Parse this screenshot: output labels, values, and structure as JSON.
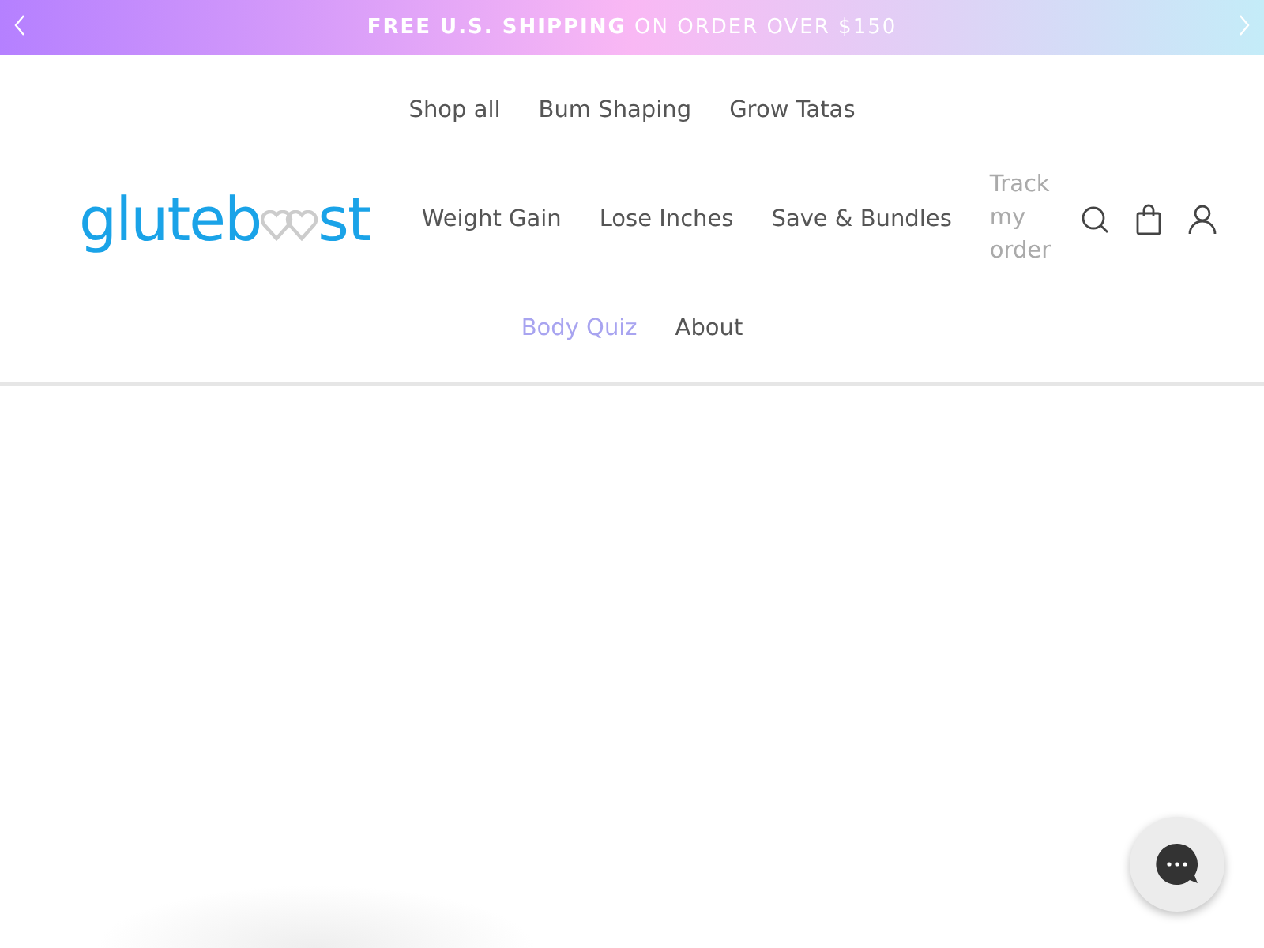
{
  "announcement": {
    "bold": "FREE U.S. SHIPPING",
    "text": "ON ORDER OVER $150"
  },
  "logo": {
    "before": "gluteb",
    "after": "st"
  },
  "nav_rows": [
    [
      {
        "label": "Shop all",
        "kind": "link",
        "selected": false
      },
      {
        "label": "Bum Shaping",
        "kind": "link",
        "selected": false
      },
      {
        "label": "Grow Tatas",
        "kind": "link",
        "selected": false
      }
    ],
    [
      {
        "label": "Weight Gain",
        "kind": "link",
        "selected": false
      },
      {
        "label": "Lose Inches",
        "kind": "link",
        "selected": false
      },
      {
        "label": "Save & Bundles",
        "kind": "link",
        "selected": false
      },
      {
        "label": "Track my order",
        "kind": "muted",
        "selected": false
      }
    ],
    [
      {
        "label": "Body Quiz",
        "kind": "link",
        "selected": true
      },
      {
        "label": "About",
        "kind": "link",
        "selected": false
      }
    ]
  ]
}
